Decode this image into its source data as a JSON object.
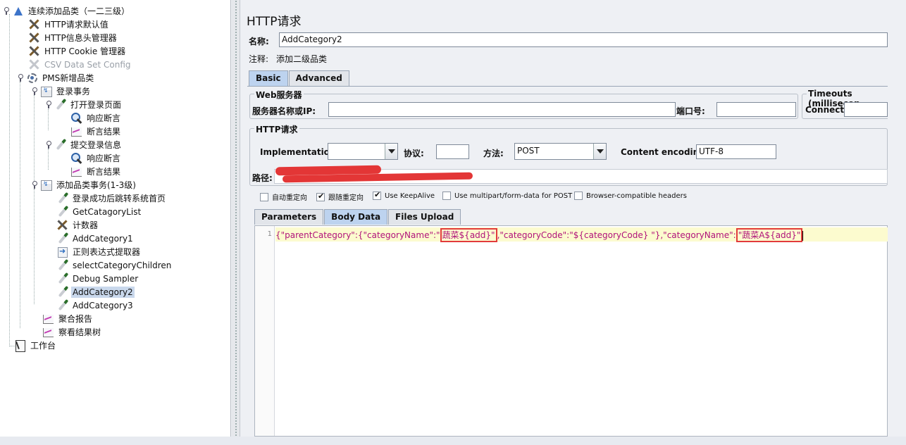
{
  "tree": {
    "items": [
      {
        "label": "连续添加品类（一二三级）",
        "icon": "test-plan-icon"
      },
      {
        "label": "HTTP请求默认值",
        "icon": "wrench-icon"
      },
      {
        "label": "HTTP信息头管理器",
        "icon": "wrench-icon"
      },
      {
        "label": "HTTP Cookie 管理器",
        "icon": "wrench-icon"
      },
      {
        "label": "CSV Data Set Config",
        "icon": "wrench-icon",
        "disabled": true
      },
      {
        "label": "PMS新增品类",
        "icon": "gear-icon"
      },
      {
        "label": "登录事务",
        "icon": "transaction-icon"
      },
      {
        "label": "打开登录页面",
        "icon": "sampler-icon"
      },
      {
        "label": "响应断言",
        "icon": "magnifier-icon"
      },
      {
        "label": "断言结果",
        "icon": "graph-icon"
      },
      {
        "label": "提交登录信息",
        "icon": "sampler-icon"
      },
      {
        "label": "响应断言",
        "icon": "magnifier-icon"
      },
      {
        "label": "断言结果",
        "icon": "graph-icon"
      },
      {
        "label": "添加品类事务(1-3级)",
        "icon": "transaction-icon"
      },
      {
        "label": "登录成功后跳转系统首页",
        "icon": "sampler-icon"
      },
      {
        "label": "GetCatagoryList",
        "icon": "sampler-icon"
      },
      {
        "label": "计数器",
        "icon": "wrench-icon"
      },
      {
        "label": "AddCategory1",
        "icon": "sampler-icon"
      },
      {
        "label": "正则表达式提取器",
        "icon": "extractor-icon"
      },
      {
        "label": "selectCategoryChildren",
        "icon": "sampler-icon"
      },
      {
        "label": "Debug Sampler",
        "icon": "sampler-icon"
      },
      {
        "label": "AddCategory2",
        "icon": "sampler-icon",
        "selected": true
      },
      {
        "label": "AddCategory3",
        "icon": "sampler-icon"
      },
      {
        "label": "聚合报告",
        "icon": "graph-icon"
      },
      {
        "label": "察看结果树",
        "icon": "graph-icon"
      },
      {
        "label": "工作台",
        "icon": "workbench-icon"
      }
    ]
  },
  "panel": {
    "title": "HTTP请求",
    "name_label": "名称:",
    "name_value": "AddCategory2",
    "comment_label": "注释:",
    "comment_value": "添加二级品类",
    "tabs": [
      "Basic",
      "Advanced"
    ],
    "web_server": {
      "legend": "Web服务器",
      "server_label": "服务器名称或IP:",
      "server_value": "",
      "port_label": "端口号:",
      "port_value": ""
    },
    "timeouts": {
      "legend": "Timeouts (millisecon",
      "connect_label": "Connect:",
      "connect_value": ""
    },
    "http_request": {
      "legend": "HTTP请求",
      "implementation_label": "Implementation:",
      "implementation_value": "",
      "protocol_label": "协议:",
      "protocol_value": "",
      "method_label": "方法:",
      "method_value": "POST",
      "encoding_label": "Content encoding:",
      "encoding_value": "UTF-8",
      "path_label": "路径:"
    },
    "checkboxes": [
      {
        "label": "自动重定向",
        "checked": false
      },
      {
        "label": "跟随重定向",
        "checked": true
      },
      {
        "label": "Use KeepAlive",
        "checked": true
      },
      {
        "label": "Use multipart/form-data for POST",
        "checked": false
      },
      {
        "label": "Browser-compatible headers",
        "checked": false
      }
    ],
    "body_tabs": [
      "Parameters",
      "Body Data",
      "Files Upload"
    ],
    "body": {
      "line_number": "1",
      "seg1": "{\"parentCategory\":{\"categoryName\":\"",
      "hl1": "蔬菜${add}\"",
      "seg2": ",\"categoryCode\":\"${categoryCode} \"},\"categoryName\":",
      "hl2": "\"蔬菜A${add}\""
    }
  },
  "colors": {
    "selection": "#c9d8ec",
    "active_tab": "#bdd3ef",
    "highlight_box": "#e23b3b",
    "code_text": "#b0127a",
    "line_highlight": "#fcfbcf"
  }
}
